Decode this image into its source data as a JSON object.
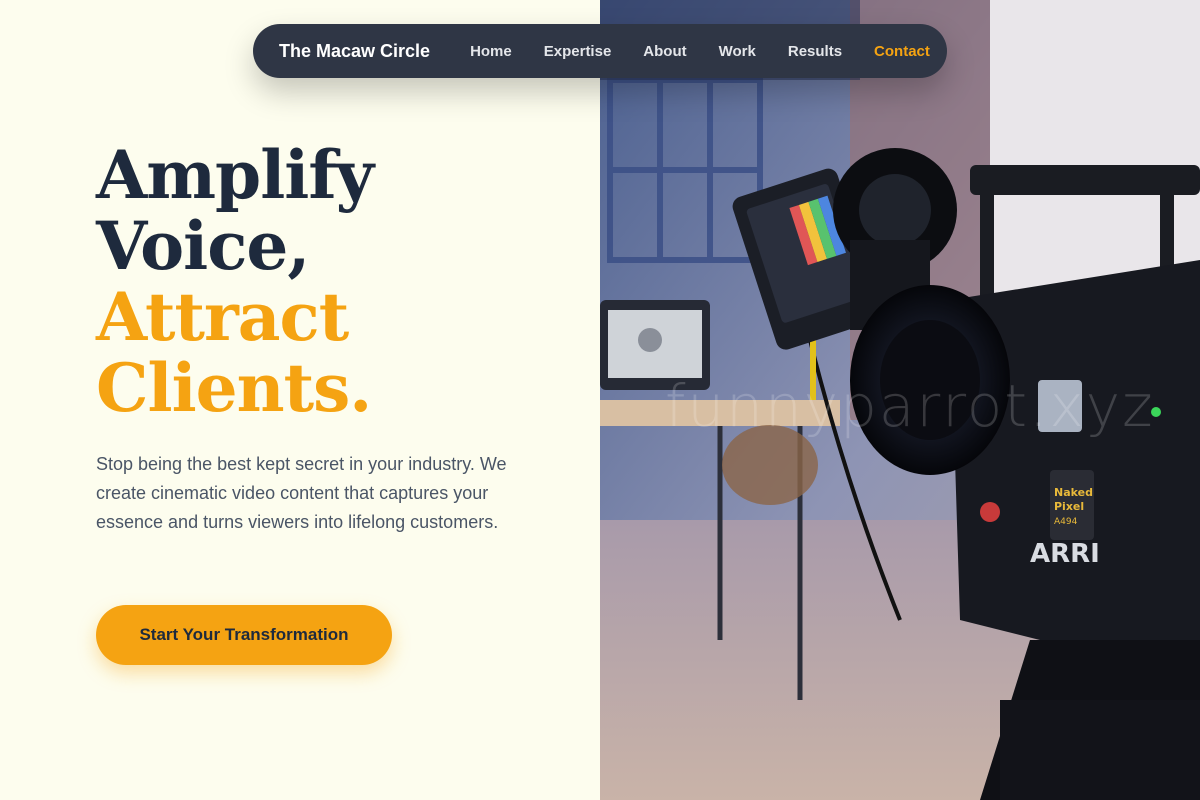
{
  "nav": {
    "brand": "The Macaw Circle",
    "links": [
      {
        "label": "Home"
      },
      {
        "label": "Expertise"
      },
      {
        "label": "About"
      },
      {
        "label": "Work"
      },
      {
        "label": "Results"
      },
      {
        "label": "Contact",
        "active": true
      }
    ]
  },
  "hero": {
    "headline_lines": [
      "Amplify",
      "Voice,",
      "Attract",
      "Clients."
    ],
    "description": "Stop being the best kept secret in your industry. We create cinematic video content that captures your essence and turns viewers into lifelong customers.",
    "cta_label": "Start Your Transformation",
    "image": {
      "camera_brand_text": "ARRI",
      "badge_text_1": "Naked",
      "badge_text_2": "Pixel",
      "badge_text_3": "A494",
      "watermark": "funnyparrot.xyz"
    }
  },
  "colors": {
    "background": "#fdfdee",
    "nav_bg": "#2f3645",
    "accent": "#f5a312",
    "heading": "#1e2a3d",
    "body_text": "#4a5566"
  }
}
